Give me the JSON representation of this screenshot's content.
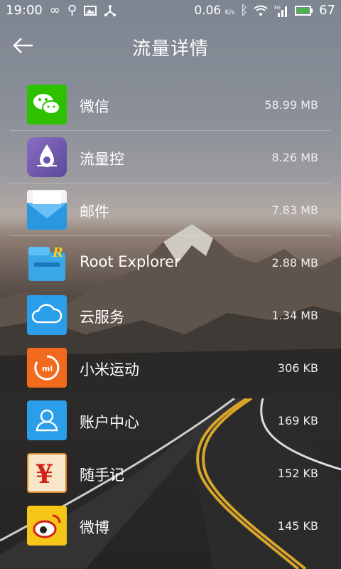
{
  "status_bar": {
    "time": "19:00",
    "data_rate": "0.06",
    "data_unit": "K/s",
    "network": "3G",
    "battery_level": "67"
  },
  "header": {
    "title": "流量详情"
  },
  "apps": [
    {
      "name": "微信",
      "size": "58.99 MB",
      "icon": "wechat-icon"
    },
    {
      "name": "流量控",
      "size": "8.26 MB",
      "icon": "traffic-control-icon"
    },
    {
      "name": "邮件",
      "size": "7.83 MB",
      "icon": "mail-icon"
    },
    {
      "name": "Root Explorer",
      "size": "2.88 MB",
      "icon": "root-explorer-icon"
    },
    {
      "name": "云服务",
      "size": "1.34 MB",
      "icon": "cloud-service-icon"
    },
    {
      "name": "小米运动",
      "size": "306 KB",
      "icon": "mi-fit-icon"
    },
    {
      "name": "账户中心",
      "size": "169 KB",
      "icon": "account-center-icon"
    },
    {
      "name": "随手记",
      "size": "152 KB",
      "icon": "suishouji-icon"
    },
    {
      "name": "微博",
      "size": "145 KB",
      "icon": "weibo-icon"
    }
  ]
}
